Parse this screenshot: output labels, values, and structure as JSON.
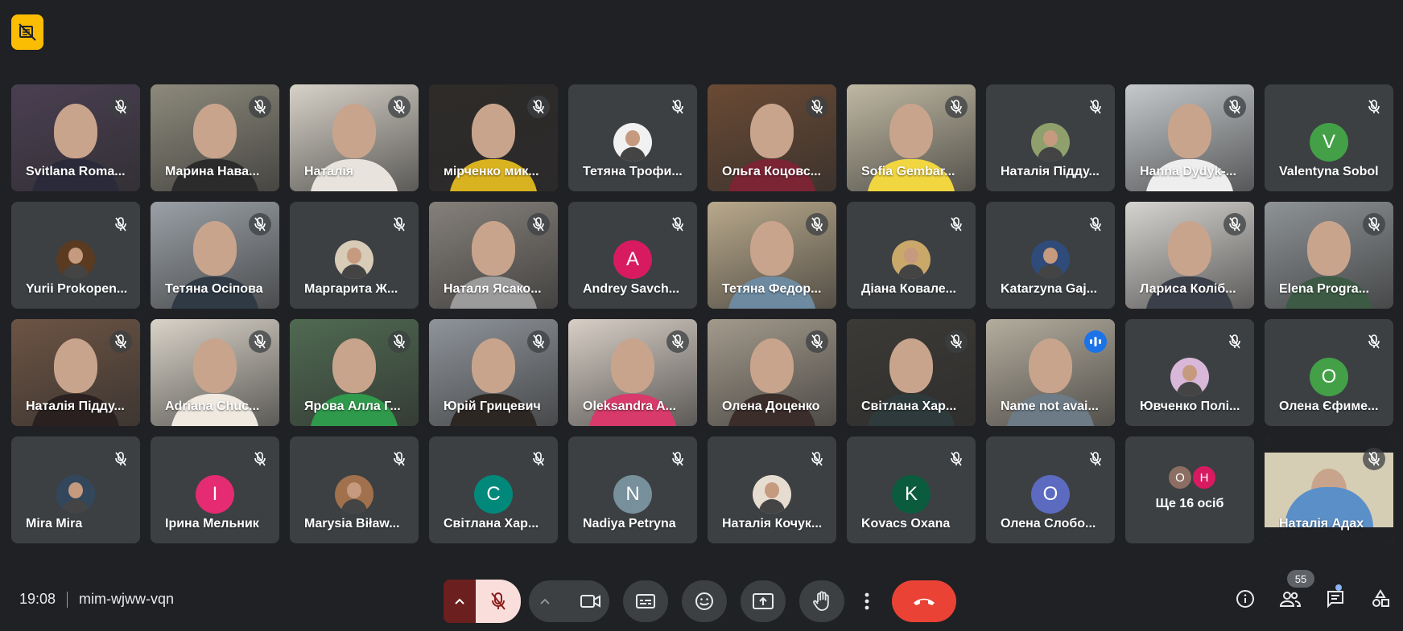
{
  "meeting": {
    "time": "19:08",
    "code": "mim-wjww-vqn"
  },
  "participants": [
    {
      "name": "Svitlana Roma...",
      "type": "video",
      "bg": "#4a3f52",
      "shirt": "#2a2a3a"
    },
    {
      "name": "Марина Нава...",
      "type": "video",
      "bg": "#8d8a7c",
      "shirt": "#2b2b2b"
    },
    {
      "name": "Наталія",
      "type": "video",
      "bg": "#d7d2c8",
      "shirt": "#e8e4dd"
    },
    {
      "name": "мірченко мик...",
      "type": "video",
      "bg": "#2e2b29",
      "shirt": "#d9b21f"
    },
    {
      "name": "Тетяна Трофи...",
      "type": "avatar-photo",
      "avatar_color": "#f1f1f1"
    },
    {
      "name": "Ольга Коцовс...",
      "type": "video",
      "bg": "#6a4a34",
      "shirt": "#7b2434"
    },
    {
      "name": "Sofia Gembar...",
      "type": "video",
      "bg": "#bfb8a2",
      "shirt": "#f2d640"
    },
    {
      "name": "Наталія Підду...",
      "type": "avatar-photo",
      "avatar_color": "#8fa06c"
    },
    {
      "name": "Hanna Dydyk-...",
      "type": "video",
      "bg": "#c5c9cc",
      "shirt": "#eeeeee"
    },
    {
      "name": "Valentynа Sobol",
      "type": "avatar",
      "letter": "V",
      "avatar_color": "#43a047"
    },
    {
      "name": "Yurii Prokopen...",
      "type": "avatar-photo",
      "avatar_color": "#5a3b22"
    },
    {
      "name": "Тетяна Осіпова",
      "type": "video",
      "bg": "#9aa0a6",
      "shirt": "#2f3a45"
    },
    {
      "name": "Маргарита Ж...",
      "type": "avatar-photo",
      "avatar_color": "#d8cbb8"
    },
    {
      "name": "Наталя Ясако...",
      "type": "video",
      "bg": "#85807a",
      "shirt": "#9b9b9b"
    },
    {
      "name": "Andrey Savch...",
      "type": "avatar",
      "letter": "A",
      "avatar_color": "#d81b60"
    },
    {
      "name": "Тетяна Федор...",
      "type": "video",
      "bg": "#b9a98c",
      "shirt": "#6d8aa0"
    },
    {
      "name": "Діана Ковале...",
      "type": "avatar-photo",
      "avatar_color": "#c9a86a"
    },
    {
      "name": "Katarzyna Gaj...",
      "type": "avatar-photo",
      "avatar_color": "#2f4b7a"
    },
    {
      "name": "Лариса Коліб...",
      "type": "video",
      "bg": "#d6d4d0",
      "shirt": "#3b3f4a"
    },
    {
      "name": "Elena Progra...",
      "type": "video",
      "bg": "#8e9396",
      "shirt": "#3c5a44"
    },
    {
      "name": "Наталія Підду...",
      "type": "video",
      "bg": "#6d5444",
      "shirt": "#2a2020"
    },
    {
      "name": "Adriana Chuc...",
      "type": "video",
      "bg": "#d9d3c8",
      "shirt": "#efe9e0"
    },
    {
      "name": "Ярова Алла Г...",
      "type": "video",
      "bg": "#506a52",
      "shirt": "#2f9a4b"
    },
    {
      "name": "Юрій Грицевич",
      "type": "video",
      "bg": "#8f949a",
      "shirt": "#2d2724"
    },
    {
      "name": "Oleksandra A...",
      "type": "video",
      "bg": "#d8cfc6",
      "shirt": "#d73a6b"
    },
    {
      "name": "Олена Доценко",
      "type": "video",
      "bg": "#a39a8c",
      "shirt": "#3a2d2a"
    },
    {
      "name": "Світлана Хар...",
      "type": "video",
      "bg": "#3c3a36",
      "shirt": "#2e3a3c"
    },
    {
      "name": "Name not avai...",
      "type": "video",
      "bg": "#b4ad9e",
      "shirt": "#6c7b86",
      "speaking": true
    },
    {
      "name": "Ювченко Полі...",
      "type": "avatar-photo",
      "avatar_color": "#d9b7d8"
    },
    {
      "name": "Олена Єфиме...",
      "type": "avatar",
      "letter": "О",
      "avatar_color": "#43a047"
    },
    {
      "name": "Mira Mira",
      "type": "avatar-photo",
      "avatar_color": "#33475c"
    },
    {
      "name": "Ірина Мельник",
      "type": "avatar",
      "letter": "І",
      "avatar_color": "#e52b72"
    },
    {
      "name": "Marysia Biław...",
      "type": "avatar-photo",
      "avatar_color": "#a0714c"
    },
    {
      "name": "Світлана Хар...",
      "type": "avatar",
      "letter": "С",
      "avatar_color": "#00897b"
    },
    {
      "name": "Nadiya Petryna",
      "type": "avatar",
      "letter": "N",
      "avatar_color": "#78909c"
    },
    {
      "name": "Наталія Кочук...",
      "type": "avatar-photo",
      "avatar_color": "#e7dcd0"
    },
    {
      "name": "Kovacs Oxana",
      "type": "avatar",
      "letter": "K",
      "avatar_color": "#0b5c3e"
    },
    {
      "name": "Олена Слобо...",
      "type": "avatar",
      "letter": "О",
      "avatar_color": "#5c6bc0"
    }
  ],
  "more_tile": {
    "label": "Ще 16 осіб",
    "avatars": [
      {
        "letter": "О",
        "color": "#8d6e63"
      },
      {
        "letter": "Н",
        "color": "#d81b60"
      }
    ]
  },
  "last_tile": {
    "name": "Наталія Адах",
    "bg": "#d6cdb5",
    "shirt": "#5b8fc7"
  },
  "people_count": "55",
  "icons": {
    "mic_off": "mic-off-icon",
    "speaking": "audio-bars-icon",
    "camera": "video-camera-icon",
    "captions": "captions-icon",
    "emoji": "emoji-icon",
    "present": "present-screen-icon",
    "hand": "raise-hand-icon",
    "more": "more-options-icon",
    "leave": "end-call-icon",
    "info": "info-icon",
    "people": "people-icon",
    "chat": "chat-icon",
    "activities": "activities-icon"
  },
  "colors": {
    "background": "#202124",
    "tile": "#3c4043",
    "leave": "#ea4335",
    "accent": "#8ab4f8",
    "badge": "#fbbc04"
  }
}
